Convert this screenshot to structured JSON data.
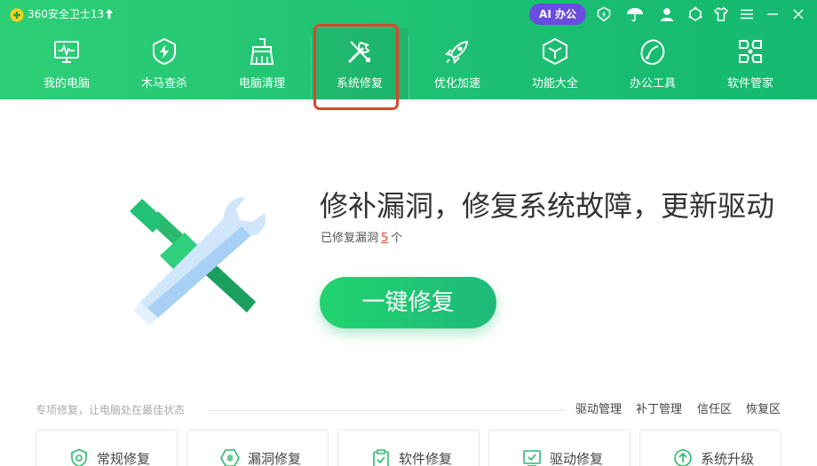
{
  "app": {
    "title": "360安全卫士13",
    "ai_button": "AI 办公"
  },
  "titlebar_icons": [
    "shield-badge-icon",
    "umbrella-icon",
    "user-icon",
    "skin-icon",
    "shirt-icon",
    "menu-icon",
    "minimize-icon",
    "close-icon"
  ],
  "nav": {
    "items": [
      {
        "id": "my-computer",
        "label": "我的电脑",
        "icon": "monitor-icon"
      },
      {
        "id": "trojan-scan",
        "label": "木马查杀",
        "icon": "shield-bolt-icon"
      },
      {
        "id": "cleanup",
        "label": "电脑清理",
        "icon": "broom-icon"
      },
      {
        "id": "system-repair",
        "label": "系统修复",
        "icon": "wrench-screwdriver-icon",
        "active": true
      },
      {
        "id": "optimize",
        "label": "优化加速",
        "icon": "rocket-icon"
      },
      {
        "id": "features",
        "label": "功能大全",
        "icon": "cube-icon"
      },
      {
        "id": "office-tools",
        "label": "办公工具",
        "icon": "pen-nib-icon"
      },
      {
        "id": "software-manager",
        "label": "软件管家",
        "icon": "apps-icon"
      }
    ]
  },
  "hero": {
    "headline": "修补漏洞，修复系统故障，更新驱动",
    "sub_prefix": "已修复漏洞",
    "count": "5",
    "sub_suffix": "个",
    "button": "一键修复"
  },
  "section": {
    "label": "专项修复，让电脑处在最佳状态",
    "links": [
      "驱动管理",
      "补丁管理",
      "信任区",
      "恢复区"
    ]
  },
  "cards": [
    {
      "label": "常规修复",
      "icon": "shield-check-icon"
    },
    {
      "label": "漏洞修复",
      "icon": "hexagon-bug-icon"
    },
    {
      "label": "软件修复",
      "icon": "clipboard-icon"
    },
    {
      "label": "驱动修复",
      "icon": "driver-check-icon"
    },
    {
      "label": "系统升级",
      "icon": "arrow-up-circle-icon"
    }
  ],
  "colors": {
    "header": "#1ec073",
    "accent": "#22d36e",
    "highlight": "#d9472b",
    "ai": "#6a4de0",
    "count": "#e8472c"
  }
}
